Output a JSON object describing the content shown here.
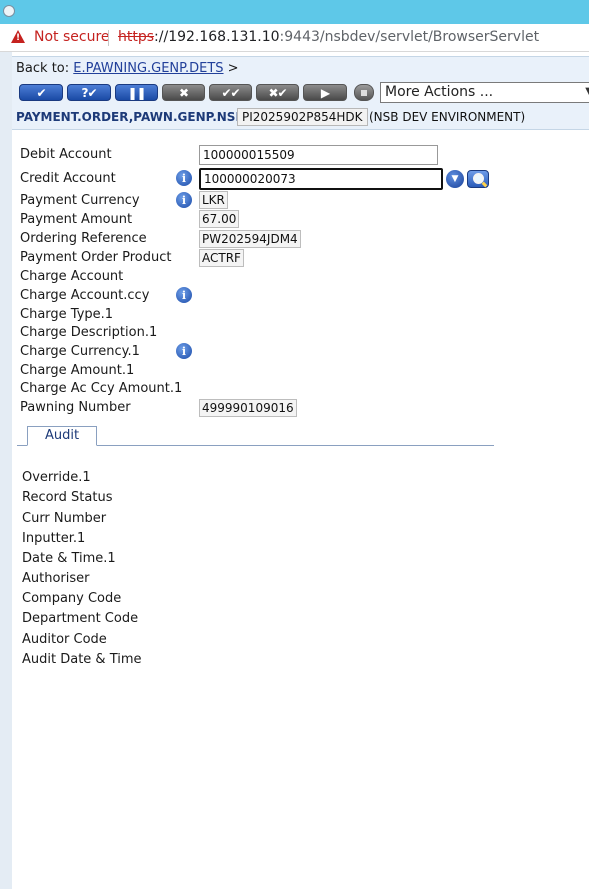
{
  "browser": {
    "security_label": "Not secure",
    "url_scheme": "https",
    "url_host": "://192.168.131.10",
    "url_rest": ":9443/nsbdev/servlet/BrowserServlet"
  },
  "header": {
    "back_prefix": "Back to:",
    "back_link": "E.PAWNING.GENP.DETS",
    "back_suffix": " >",
    "actions_select": "More Actions ...",
    "app_name": "PAYMENT.ORDER,PAWN.GENP.NSB",
    "transaction_id": "PI2025902P854HDK",
    "environment": "(NSB DEV ENVIRONMENT)"
  },
  "toolbar": {
    "buttons": [
      {
        "label": "✔"
      },
      {
        "label": "?✔"
      },
      {
        "label": "❚❚"
      },
      {
        "label": "✖"
      },
      {
        "label": "✔✔"
      },
      {
        "label": "✖✔"
      },
      {
        "label": "▶"
      }
    ]
  },
  "form": {
    "debit_account": {
      "label": "Debit Account",
      "value": "100000015509"
    },
    "credit_account": {
      "label": "Credit Account",
      "value": "100000020073"
    },
    "payment_currency": {
      "label": "Payment Currency",
      "value": "LKR"
    },
    "payment_amount": {
      "label": "Payment Amount",
      "value": "67.00"
    },
    "ordering_reference": {
      "label": "Ordering Reference",
      "value": "PW202594JDM4"
    },
    "payment_order_product": {
      "label": "Payment Order Product",
      "value": "ACTRF"
    },
    "charge_account": {
      "label": "Charge Account"
    },
    "charge_account_ccy": {
      "label": "Charge Account.ccy"
    },
    "charge_type": {
      "label": "Charge Type.1"
    },
    "charge_description": {
      "label": "Charge Description.1"
    },
    "charge_currency": {
      "label": "Charge Currency.1"
    },
    "charge_amount": {
      "label": "Charge Amount.1"
    },
    "charge_ac_ccy_amount": {
      "label": "Charge Ac Ccy Amount.1"
    },
    "pawning_number": {
      "label": "Pawning Number",
      "value": "499990109016"
    }
  },
  "tabs": [
    {
      "label": "Audit"
    }
  ],
  "audit": {
    "fields": [
      "Override.1",
      "Record Status",
      "Curr Number",
      "Inputter.1",
      "Date & Time.1",
      "Authoriser",
      "Company Code",
      "Department Code",
      "Auditor Code",
      "Audit Date & Time"
    ]
  },
  "icons": {
    "info": "info-icon",
    "dropdown": "chevron-down-icon",
    "lookup": "search-icon",
    "warning": "warning-icon"
  },
  "colors": {
    "titlebar": "#5ec8e8",
    "insecure": "#c5221f",
    "accent": "#1d3a78",
    "toolbar_blue": "#1a4aa5"
  }
}
